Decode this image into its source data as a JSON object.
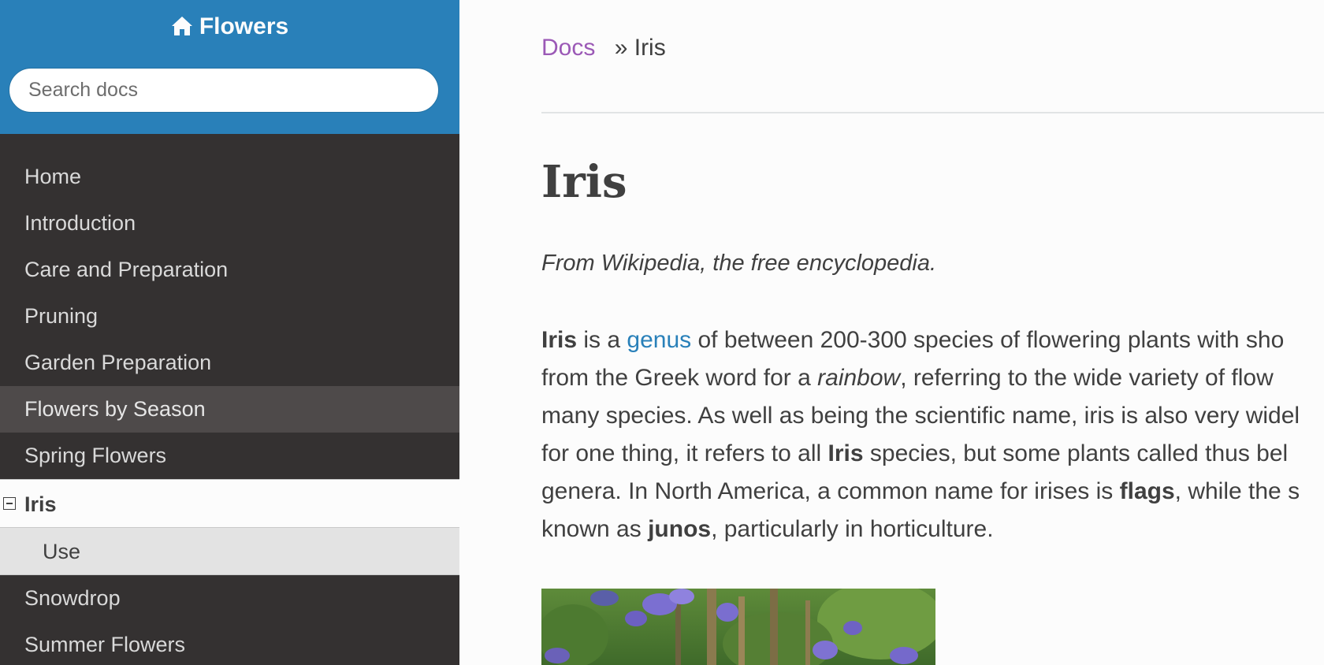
{
  "sidebar": {
    "brand": "Flowers",
    "search_placeholder": "Search docs",
    "items": [
      {
        "label": "Home"
      },
      {
        "label": "Introduction"
      },
      {
        "label": "Care and Preparation"
      },
      {
        "label": "Pruning"
      },
      {
        "label": "Garden Preparation"
      },
      {
        "label": "Flowers by Season"
      },
      {
        "label": "Spring Flowers"
      }
    ],
    "current": "Iris",
    "sub_items": [
      {
        "label": "Use"
      }
    ],
    "after": [
      {
        "label": "Snowdrop"
      },
      {
        "label": "Summer Flowers"
      }
    ]
  },
  "breadcrumb": {
    "root": "Docs",
    "separator": "»",
    "current": "Iris"
  },
  "page": {
    "title": "Iris",
    "source_note": "From Wikipedia, the free encyclopedia.",
    "para": {
      "l1a": "Iris",
      "l1b": " is a ",
      "l1c": "genus",
      "l1d": " of between 200-300 species of flowering plants with sho",
      "l2a": "from the Greek word for a ",
      "l2b": "rainbow",
      "l2c": ", referring to the wide variety of flow",
      "l3": "many species. As well as being the scientific name, iris is also very widel",
      "l4a": "for one thing, it refers to all ",
      "l4b": "Iris",
      "l4c": " species, but some plants called thus bel",
      "l5a": "genera. In North America, a common name for irises is ",
      "l5b": "flags",
      "l5c": ", while the s",
      "l6a": "known as ",
      "l6b": "junos",
      "l6c": ", particularly in horticulture."
    }
  },
  "colors": {
    "header_blue": "#2980b9",
    "sidebar_dark": "#343131",
    "link_visited": "#9b59b6",
    "link": "#2980b9"
  },
  "icons": {
    "brand": "home-icon",
    "current_toggle": "collapse-icon"
  }
}
